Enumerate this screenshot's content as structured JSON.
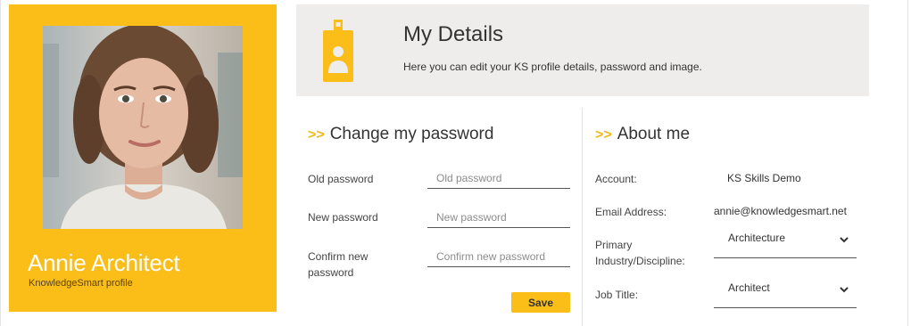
{
  "profile": {
    "name": "Annie Architect",
    "subtitle": "KnowledgeSmart profile",
    "photo": "profile-photo"
  },
  "header": {
    "title": "My Details",
    "description": "Here you can edit your KS profile details, password and image.",
    "icon": "id-badge-icon"
  },
  "password": {
    "title_prefix": ">>",
    "title": "Change my password",
    "fields": [
      {
        "label": "Old password",
        "placeholder": "Old password",
        "value": ""
      },
      {
        "label": "New password",
        "placeholder": "New password",
        "value": ""
      },
      {
        "label": "Confirm new password",
        "placeholder": "Confirm new password",
        "value": ""
      }
    ],
    "save_label": "Save"
  },
  "about": {
    "title_prefix": ">>",
    "title": "About me",
    "account_label": "Account:",
    "account_value": "KS Skills Demo",
    "email_label": "Email Address:",
    "email_value": "annie@knowledgesmart.net",
    "industry_label": "Primary Industry/Discipline:",
    "industry_value": "Architecture",
    "job_label": "Job Title:",
    "job_value": "Architect"
  },
  "colors": {
    "accent": "#fbbd18",
    "header_bg": "#eeedeb",
    "text": "#333333"
  }
}
